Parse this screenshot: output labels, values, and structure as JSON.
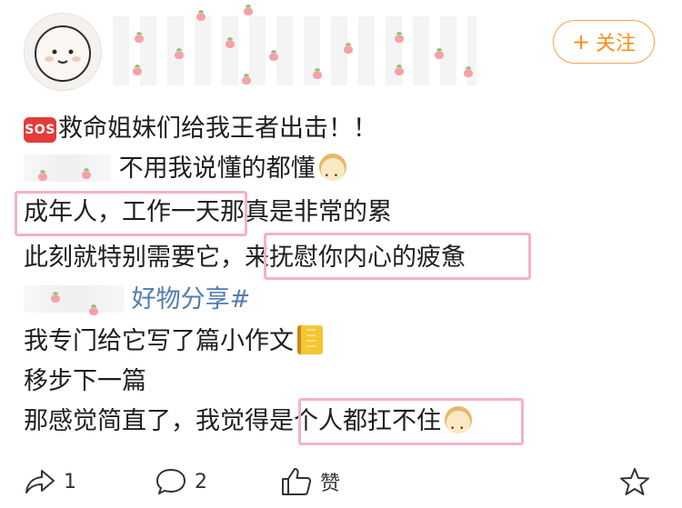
{
  "header": {
    "follow_label": "关注",
    "follow_prefix": "+"
  },
  "post": {
    "line1": "救命姐妹们给我王者出击！！",
    "sos_badge": "SOS",
    "line2": "不用我说懂的都懂",
    "line3": "成年人，工作一天那真是非常的累",
    "line4": "此刻就特别需要它，来抚慰你内心的疲惫",
    "line5_hashtag": "好物分享#",
    "line6": "我专门给它写了篇小作文",
    "line7": "移步下一篇",
    "line8": "那感觉简直了，我觉得是个人都扛不住"
  },
  "actions": {
    "share_count": "1",
    "comment_count": "2",
    "like_label": "赞"
  },
  "colors": {
    "follow": "#ff8c1a",
    "highlight": "#f5b2c4",
    "hashtag": "#507daf"
  },
  "icons": [
    "share-icon",
    "comment-icon",
    "like-icon",
    "star-icon",
    "sos-emoji",
    "doge-emoji",
    "notebook-emoji"
  ]
}
